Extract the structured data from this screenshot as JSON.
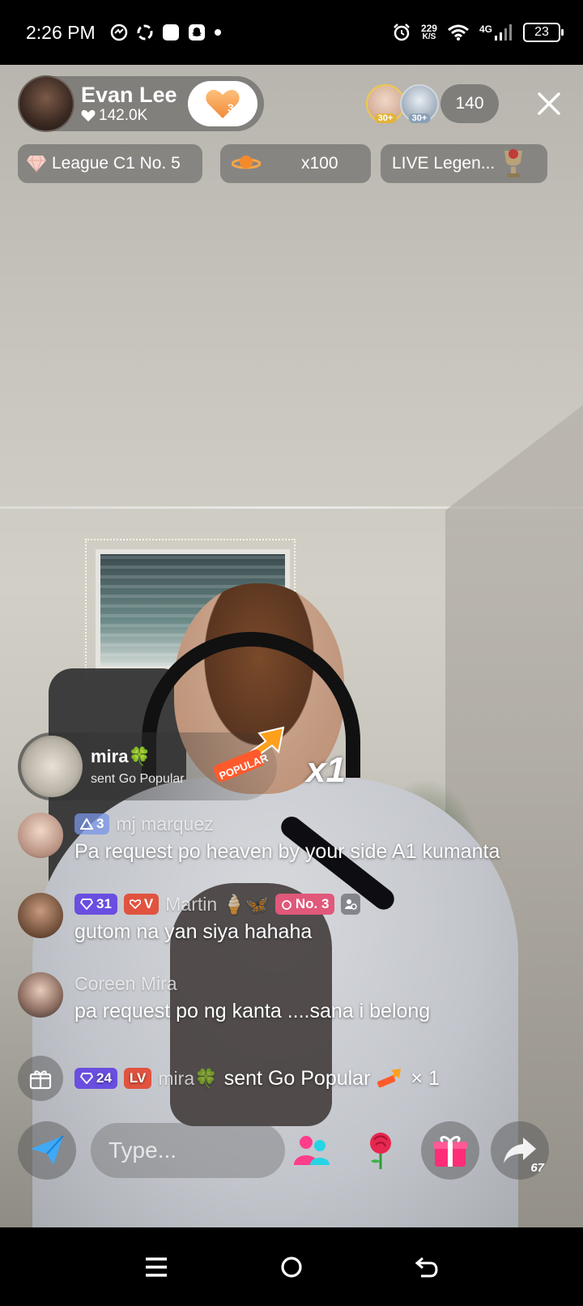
{
  "status_bar": {
    "time": "2:26 PM",
    "net_speed_value": "229",
    "net_speed_unit": "K/S",
    "network": "4G",
    "battery": "23"
  },
  "host": {
    "name": "Evan Lee",
    "likes": "142.0K",
    "follow_level": "3"
  },
  "viewers": {
    "top_ranks": [
      "30+",
      "30+"
    ],
    "count": "140"
  },
  "badges": {
    "league": "League C1 No. 5",
    "multiplier": "x100",
    "live_legend": "LIVE Legen..."
  },
  "gift_popup": {
    "user": "mira🍀",
    "action": "sent Go Popular",
    "sticker_text": "POPULAR",
    "multiplier": "x1"
  },
  "chat": [
    {
      "user": "mj marquez",
      "tags": [
        {
          "text": "3",
          "style": "blue",
          "icon": "triangle-badge-icon"
        }
      ],
      "message": "Pa request po heaven by your side A1 kumanta"
    },
    {
      "user": "Martin 🍦🦋",
      "tags": [
        {
          "text": "31",
          "style": "purple",
          "icon": "diamond-icon"
        },
        {
          "text": "V",
          "style": "red",
          "icon": "heart-icon"
        }
      ],
      "extra_tag": "No. 3",
      "message": "gutom na yan siya hahaha"
    },
    {
      "user": "Coreen Mira",
      "tags": [],
      "message": "pa request po ng kanta ....sana i belong"
    }
  ],
  "gift_line": {
    "level": "24",
    "fan_badge": "LV",
    "user": "mira🍀",
    "text": "sent Go Popular",
    "count": "× 1"
  },
  "input": {
    "placeholder": "Type..."
  },
  "share_count": "67",
  "colors": {
    "pill_bg": "rgba(60,60,60,0.42)",
    "accent_orange": "#f7a54a",
    "tag_purple": "#6a4ee0",
    "tag_red": "#e0533f"
  }
}
